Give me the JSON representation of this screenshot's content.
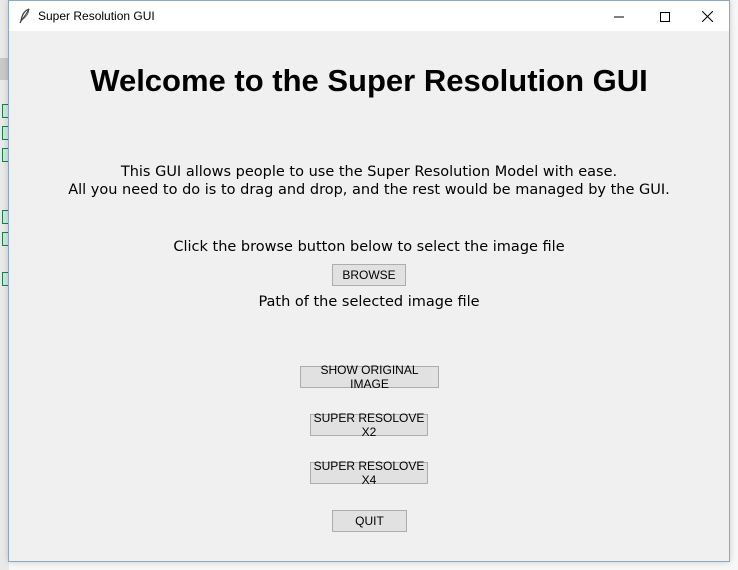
{
  "window": {
    "title": "Super Resolution GUI"
  },
  "main": {
    "heading": "Welcome to the Super Resolution GUI",
    "description_line1": "This GUI allows people to use the Super Resolution Model with ease.",
    "description_line2": "All you need to do is to drag and drop, and the rest would be managed by the GUI.",
    "instruction": "Click the browse button below to select the image file",
    "path_label": "Path of the selected image file"
  },
  "buttons": {
    "browse": "BROWSE",
    "show_original": "SHOW ORIGINAL IMAGE",
    "super_x2": "SUPER RESOLOVE X2",
    "super_x4": "SUPER RESOLOVE X4",
    "quit": "QUIT"
  },
  "icons": {
    "app": "feather-icon",
    "minimize": "minimize-icon",
    "maximize": "maximize-icon",
    "close": "close-icon"
  }
}
